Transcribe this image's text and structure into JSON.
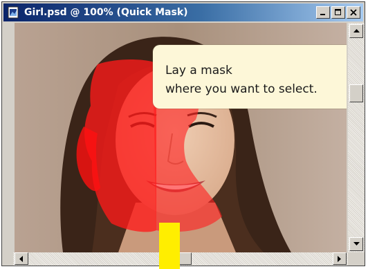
{
  "window": {
    "title": "Girl.psd @ 100% (Quick Mask)",
    "controls": [
      "minimize",
      "maximize",
      "close"
    ]
  },
  "tooltip": {
    "line1": "Lay a mask",
    "line2": "where you want to select."
  },
  "mask": {
    "mode": "Quick Mask",
    "overlay_color": "#ff1a1a",
    "zoom": "100%"
  },
  "icons": {
    "document": "photoshop-document-icon",
    "minimize": "minimize-icon",
    "maximize": "maximize-icon",
    "close": "close-icon",
    "up": "arrow-up-icon",
    "down": "arrow-down-icon",
    "left": "arrow-left-icon",
    "right": "arrow-right-icon"
  },
  "colors": {
    "title_bar": "#0a246a",
    "tooltip_bg": "#fdf7d8",
    "marker": "#ffee00"
  }
}
